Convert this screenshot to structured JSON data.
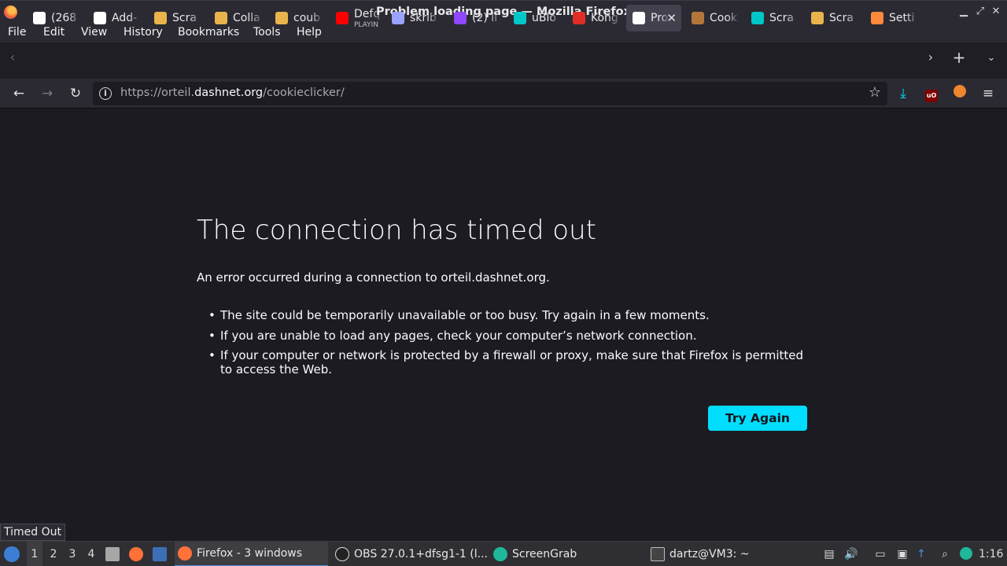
{
  "window": {
    "title": "Problem loading page — Mozilla Firefox"
  },
  "menu": [
    "File",
    "Edit",
    "View",
    "History",
    "Bookmarks",
    "Tools",
    "Help"
  ],
  "tabs": [
    {
      "label": "(268",
      "icon": "github-icon",
      "color": "#ffffff"
    },
    {
      "label": "Add-",
      "icon": "puzzle-icon",
      "color": "#ffffff"
    },
    {
      "label": "Scra",
      "icon": "cookie-icon",
      "color": "#e9b44c"
    },
    {
      "label": "Colla",
      "icon": "cookie-icon",
      "color": "#e9b44c"
    },
    {
      "label": "coub",
      "icon": "cookie-icon",
      "color": "#e9b44c"
    },
    {
      "label": "Defq",
      "sub": "PLAYIN",
      "icon": "youtube-icon",
      "color": "#ff0000"
    },
    {
      "label": "skrib",
      "icon": "pencil-icon",
      "color": "#9aa3ff"
    },
    {
      "label": "(2) lI",
      "icon": "twitch-icon",
      "color": "#9146ff"
    },
    {
      "label": "uBlo",
      "icon": "gear-icon",
      "color": "#00c8c8"
    },
    {
      "label": "Kong",
      "icon": "kongregate-icon",
      "color": "#e22d27"
    },
    {
      "label": "Pro",
      "icon": "info-icon",
      "color": "#ffffff",
      "active": true
    },
    {
      "label": "Cook",
      "icon": "cookie-face-icon",
      "color": "#b5763a"
    },
    {
      "label": "Scra",
      "icon": "gear-icon",
      "color": "#00c8c8"
    },
    {
      "label": "Scra",
      "icon": "cookie-icon",
      "color": "#e9b44c"
    },
    {
      "label": "Setti",
      "icon": "settings-icon",
      "color": "#ff8a3c"
    }
  ],
  "url": {
    "prefix": "https://orteil.",
    "domain": "dashnet.org",
    "path": "/cookieclicker/"
  },
  "error": {
    "title": "The connection has timed out",
    "description": "An error occurred during a connection to orteil.dashnet.org.",
    "bullets": [
      "The site could be temporarily unavailable or too busy. Try again in a few moments.",
      "If you are unable to load any pages, check your computer’s network connection.",
      "If your computer or network is protected by a firewall or proxy, make sure that Firefox is permitted to access the Web."
    ],
    "button": "Try Again"
  },
  "status_text": "Timed Out",
  "taskbar": {
    "workspaces": [
      "1",
      "2",
      "3",
      "4"
    ],
    "windows": [
      {
        "label": "Firefox - 3 windows"
      },
      {
        "label": "OBS 27.0.1+dfsg1-1 (l..."
      },
      {
        "label": "ScreenGrab"
      },
      {
        "label": "dartz@VM3: ~"
      }
    ],
    "clock": "1:16"
  },
  "colors": {
    "accent": "#00ddff",
    "background": "#1c1b22",
    "chrome": "#2b2a33"
  }
}
